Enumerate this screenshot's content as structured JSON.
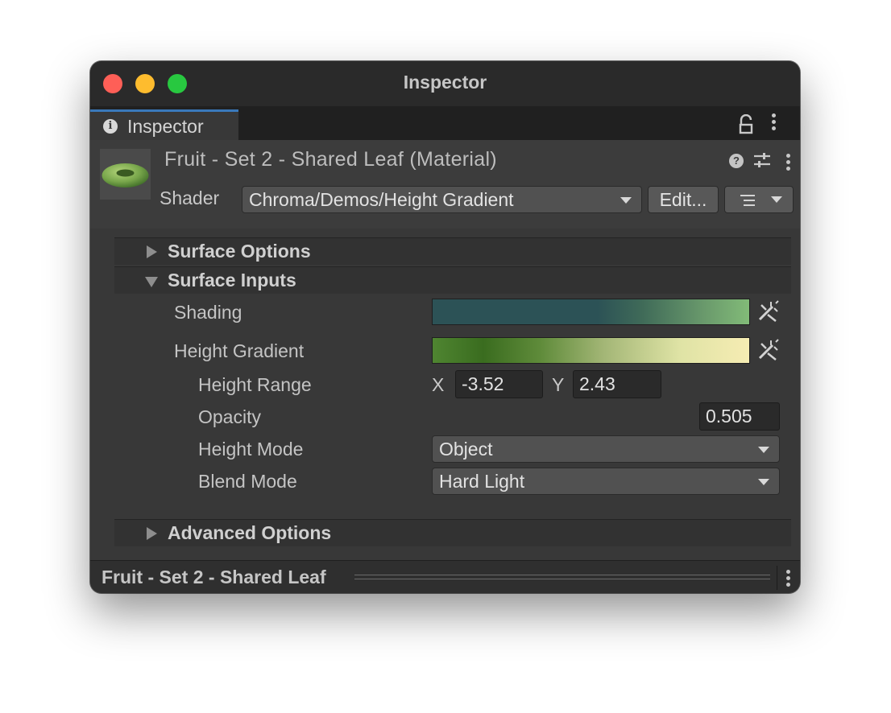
{
  "window": {
    "title": "Inspector"
  },
  "tab": {
    "label": "Inspector"
  },
  "header": {
    "material_title": "Fruit - Set 2 - Shared Leaf (Material)",
    "shader_label": "Shader",
    "shader_value": "Chroma/Demos/Height Gradient",
    "edit_button": "Edit..."
  },
  "sections": {
    "surface_options": "Surface Options",
    "surface_inputs": "Surface Inputs",
    "advanced_options": "Advanced Options"
  },
  "properties": {
    "shading_label": "Shading",
    "height_gradient_label": "Height Gradient",
    "height_range": {
      "label": "Height Range",
      "x_label": "X",
      "x_value": "-3.52",
      "y_label": "Y",
      "y_value": "2.43"
    },
    "opacity": {
      "label": "Opacity",
      "value": "0.505",
      "fraction": 0.505
    },
    "height_mode": {
      "label": "Height Mode",
      "value": "Object"
    },
    "blend_mode": {
      "label": "Blend Mode",
      "value": "Hard Light"
    }
  },
  "footer": {
    "title": "Fruit - Set 2 - Shared Leaf"
  },
  "colors": {
    "accent_tab": "#3a79bb",
    "traffic_red": "#fe5f57",
    "traffic_yellow": "#febc2e",
    "traffic_green": "#28c840"
  }
}
